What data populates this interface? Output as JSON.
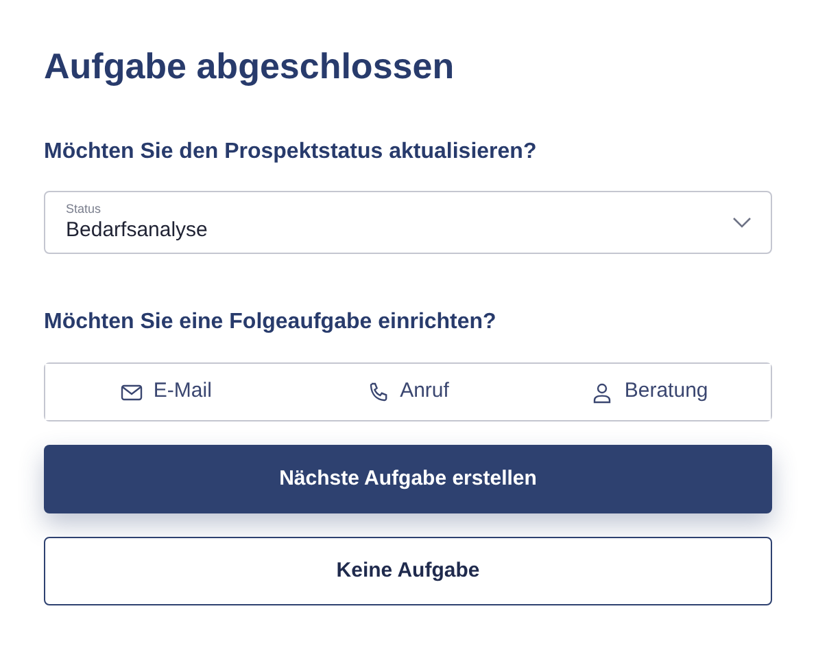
{
  "title": "Aufgabe abgeschlossen",
  "status_question": "Möchten Sie den Prospektstatus aktualisieren?",
  "status_field": {
    "label": "Status",
    "value": "Bedarfsanalyse"
  },
  "followup_question": "Möchten Sie eine Folgeaufgabe einrichten?",
  "task_types": [
    {
      "kind": "email",
      "label": "E-Mail",
      "selected": false
    },
    {
      "kind": "call",
      "label": "Anruf",
      "selected": false
    },
    {
      "kind": "meeting",
      "label": "Beratung",
      "selected": false
    }
  ],
  "buttons": [
    {
      "kind": "primary",
      "label": "Nächste Aufgabe erstellen"
    },
    {
      "kind": "secondary",
      "label": "Keine Aufgabe"
    }
  ]
}
